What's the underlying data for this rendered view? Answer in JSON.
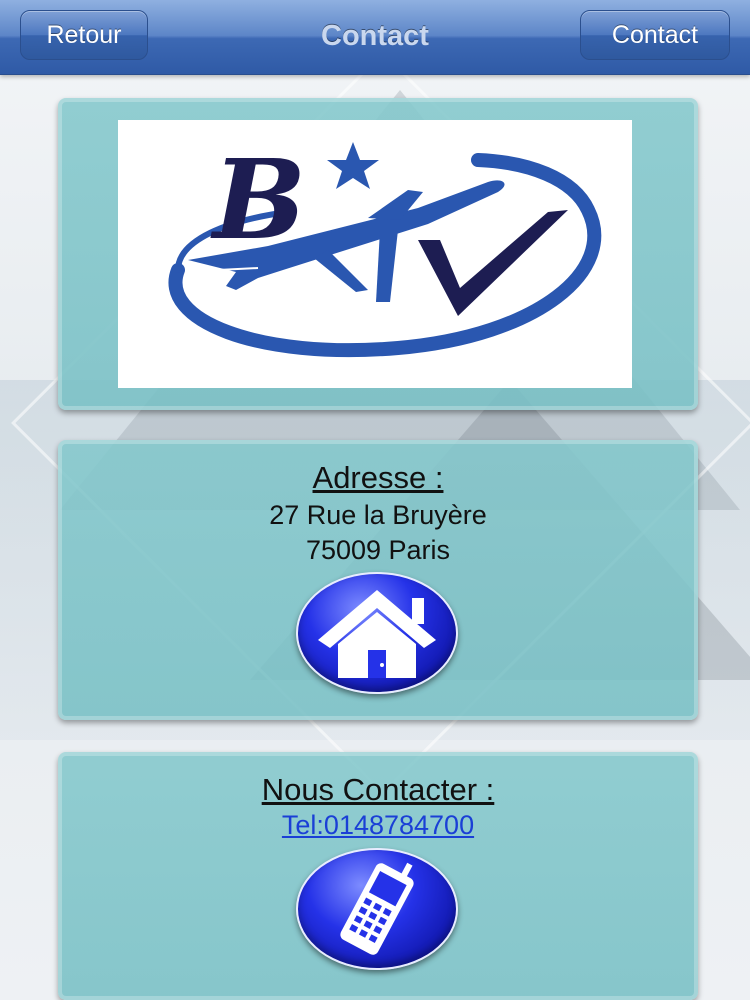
{
  "navbar": {
    "title": "Contact",
    "back_label": "Retour",
    "right_label": "Contact"
  },
  "logo": {
    "letters": "BTV"
  },
  "address": {
    "title": "Adresse :",
    "street": "27 Rue la Bruyère",
    "city": "75009 Paris",
    "button_icon": "home-icon"
  },
  "contact": {
    "title": "Nous Contacter :",
    "phone_link": "Tel:0148784700",
    "button_icon": "mobile-phone-icon"
  },
  "colors": {
    "navbar": "#3d69b4",
    "card": "#84c8cc",
    "link": "#1a3fd6",
    "button": "#2532e8",
    "logo_blue": "#2a57b0",
    "logo_navy": "#1d1d52"
  }
}
